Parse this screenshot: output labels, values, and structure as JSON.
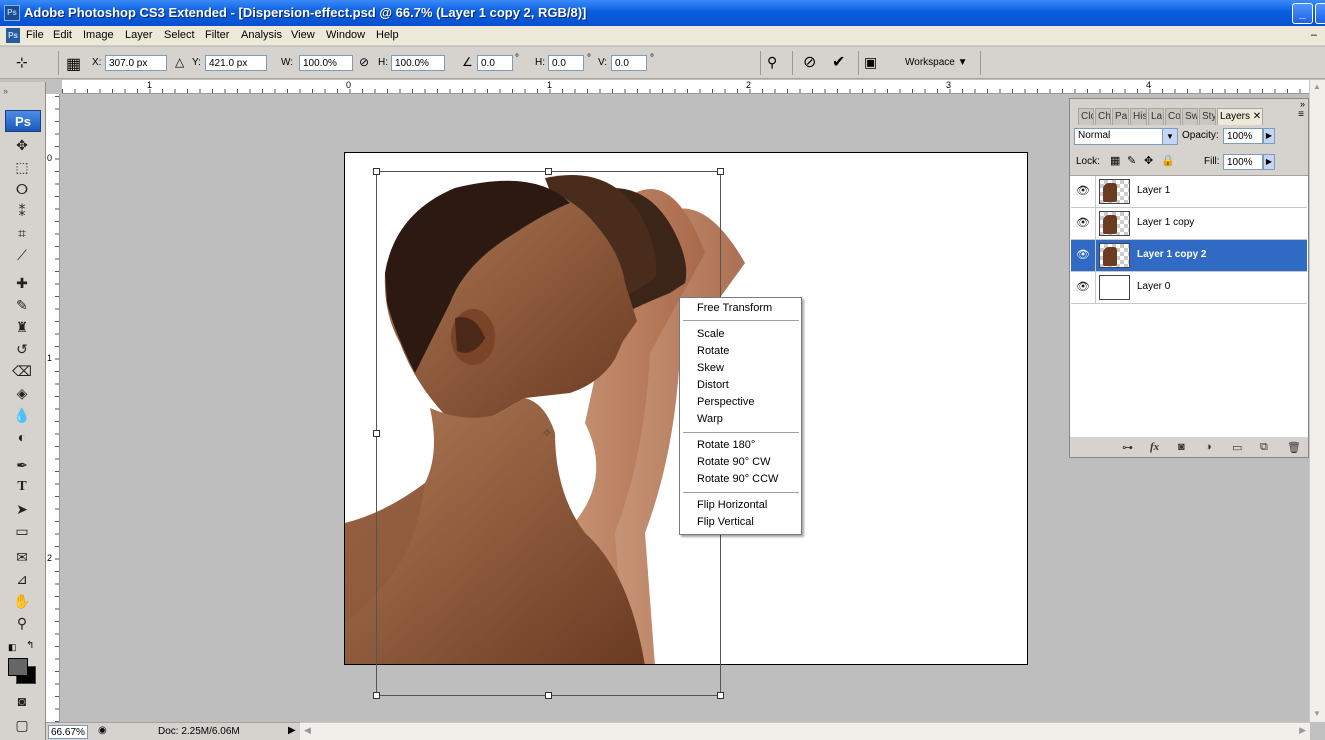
{
  "window": {
    "title": "Adobe Photoshop CS3 Extended - [Dispersion-effect.psd @ 66.7% (Layer 1 copy 2, RGB/8)]",
    "app_icon": "Ps",
    "minimize": "_",
    "maximize": "□",
    "close": "✕"
  },
  "menu": {
    "items": [
      "File",
      "Edit",
      "Image",
      "Layer",
      "Select",
      "Filter",
      "Analysis",
      "View",
      "Window",
      "Help"
    ],
    "restore": "–"
  },
  "options": {
    "x_label": "X:",
    "x_value": "307.0 px",
    "y_label": "Y:",
    "y_value": "421.0 px",
    "w_label": "W:",
    "w_value": "100.0%",
    "h_label": "H:",
    "h_value": "100.0%",
    "angle_value": "0.0",
    "hskew_label": "H:",
    "hskew_value": "0.0",
    "vskew_label": "V:",
    "vskew_value": "0.0",
    "degree": "°",
    "workspace": "Workspace ▼"
  },
  "tools": {
    "badge": "Ps",
    "icons": [
      "move-icon",
      "marquee-icon",
      "lasso-icon",
      "magic-wand-icon",
      "crop-icon",
      "slice-icon",
      "healing-brush-icon",
      "brush-icon",
      "clone-stamp-icon",
      "history-brush-icon",
      "eraser-icon",
      "paint-bucket-icon",
      "blur-icon",
      "dodge-icon",
      "pen-icon",
      "type-icon",
      "path-selection-icon",
      "rectangle-icon",
      "notes-icon",
      "eyedropper-icon",
      "hand-icon",
      "zoom-icon"
    ]
  },
  "rulers": {
    "top_labels": [
      "1",
      "0",
      "1",
      "2",
      "3",
      "4"
    ],
    "left_labels": [
      "0",
      "1",
      "2"
    ]
  },
  "context_menu": {
    "items": [
      "Free Transform",
      "Scale",
      "Rotate",
      "Skew",
      "Distort",
      "Perspective",
      "Warp",
      "Rotate 180°",
      "Rotate 90° CW",
      "Rotate 90° CCW",
      "Flip Horizontal",
      "Flip Vertical"
    ]
  },
  "layers_panel": {
    "tabs": [
      "Clo",
      "Ch",
      "Pa",
      "His",
      "La",
      "Co",
      "Sw",
      "Sty",
      "Layers"
    ],
    "active_tab": "Layers",
    "blend_mode": "Normal",
    "opacity_label": "Opacity:",
    "opacity_value": "100%",
    "lock_label": "Lock:",
    "fill_label": "Fill:",
    "fill_value": "100%",
    "layers": [
      {
        "name": "Layer 1",
        "selected": false
      },
      {
        "name": "Layer 1 copy",
        "selected": false
      },
      {
        "name": "Layer 1 copy 2",
        "selected": true
      },
      {
        "name": "Layer 0",
        "selected": false
      }
    ]
  },
  "status": {
    "zoom": "66.67%",
    "doc": "Doc: 2.25M/6.06M"
  },
  "colors": {
    "selection": "#316ac5",
    "titlebar": "#0a5fe0",
    "skin": "#8a5236"
  }
}
